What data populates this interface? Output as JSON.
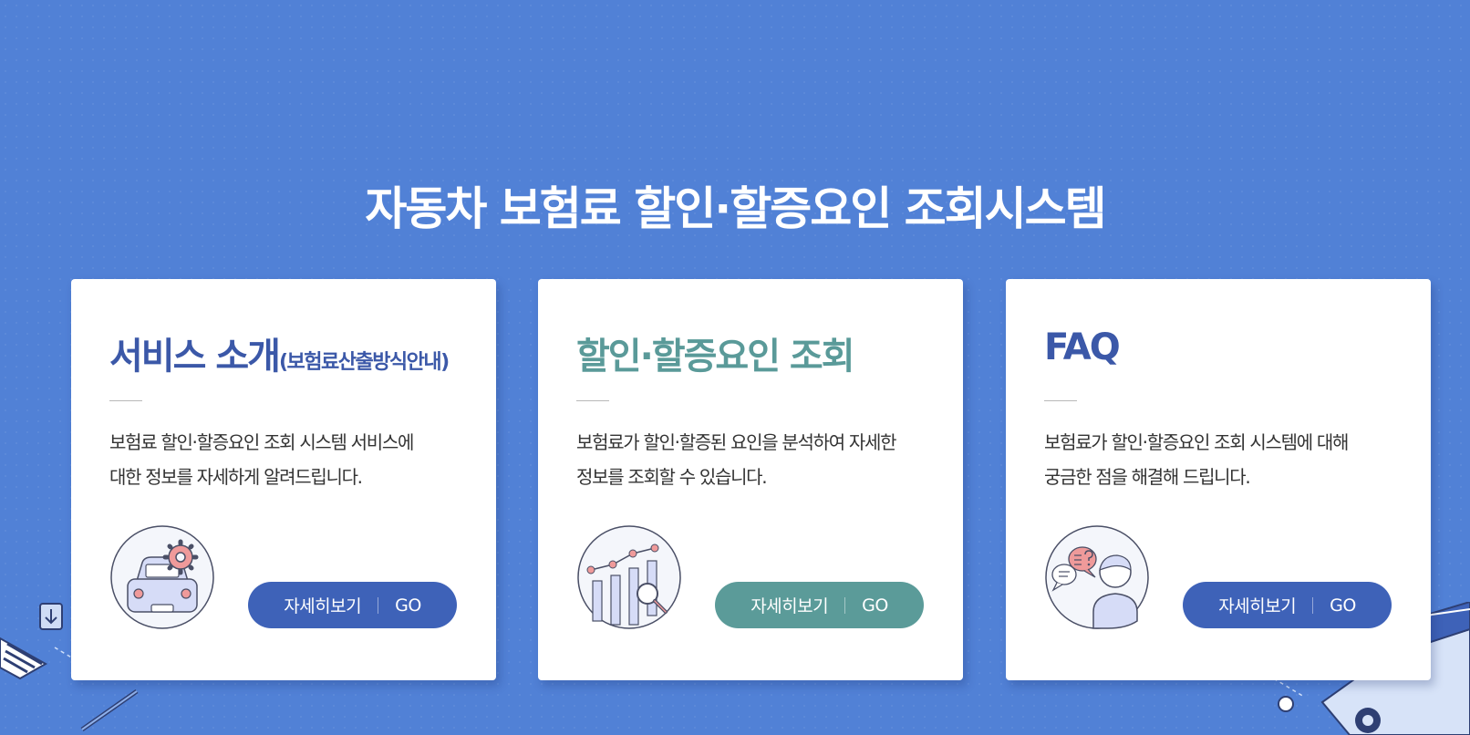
{
  "page": {
    "title": "자동차 보험료 할인·할증요인 조회시스템"
  },
  "cards": [
    {
      "title": "서비스 소개",
      "title_sub": "(보험료산출방식안내)",
      "desc_line1": "보험료 할인·할증요인 조회 시스템 서비스에",
      "desc_line2": "대한 정보를 자세하게 알려드립니다.",
      "icon": "car-gear-icon",
      "button_label": "자세히보기",
      "button_go": "GO"
    },
    {
      "title": "할인·할증요인 조회",
      "desc_line1": "보험료가 할인·할증된 요인을 분석하여 자세한",
      "desc_line2": "정보를 조회할 수 있습니다.",
      "icon": "chart-magnifier-icon",
      "button_label": "자세히보기",
      "button_go": "GO"
    },
    {
      "title": "FAQ",
      "desc_line1": "보험료가 할인·할증요인 조회 시스템에 대해",
      "desc_line2": "궁금한 점을 해결해 드립니다.",
      "icon": "person-chat-icon",
      "button_label": "자세히보기",
      "button_go": "GO"
    }
  ],
  "colors": {
    "background": "#5181d6",
    "primary_blue": "#3e62b8",
    "teal": "#5b9b99",
    "card_bg": "#ffffff"
  }
}
